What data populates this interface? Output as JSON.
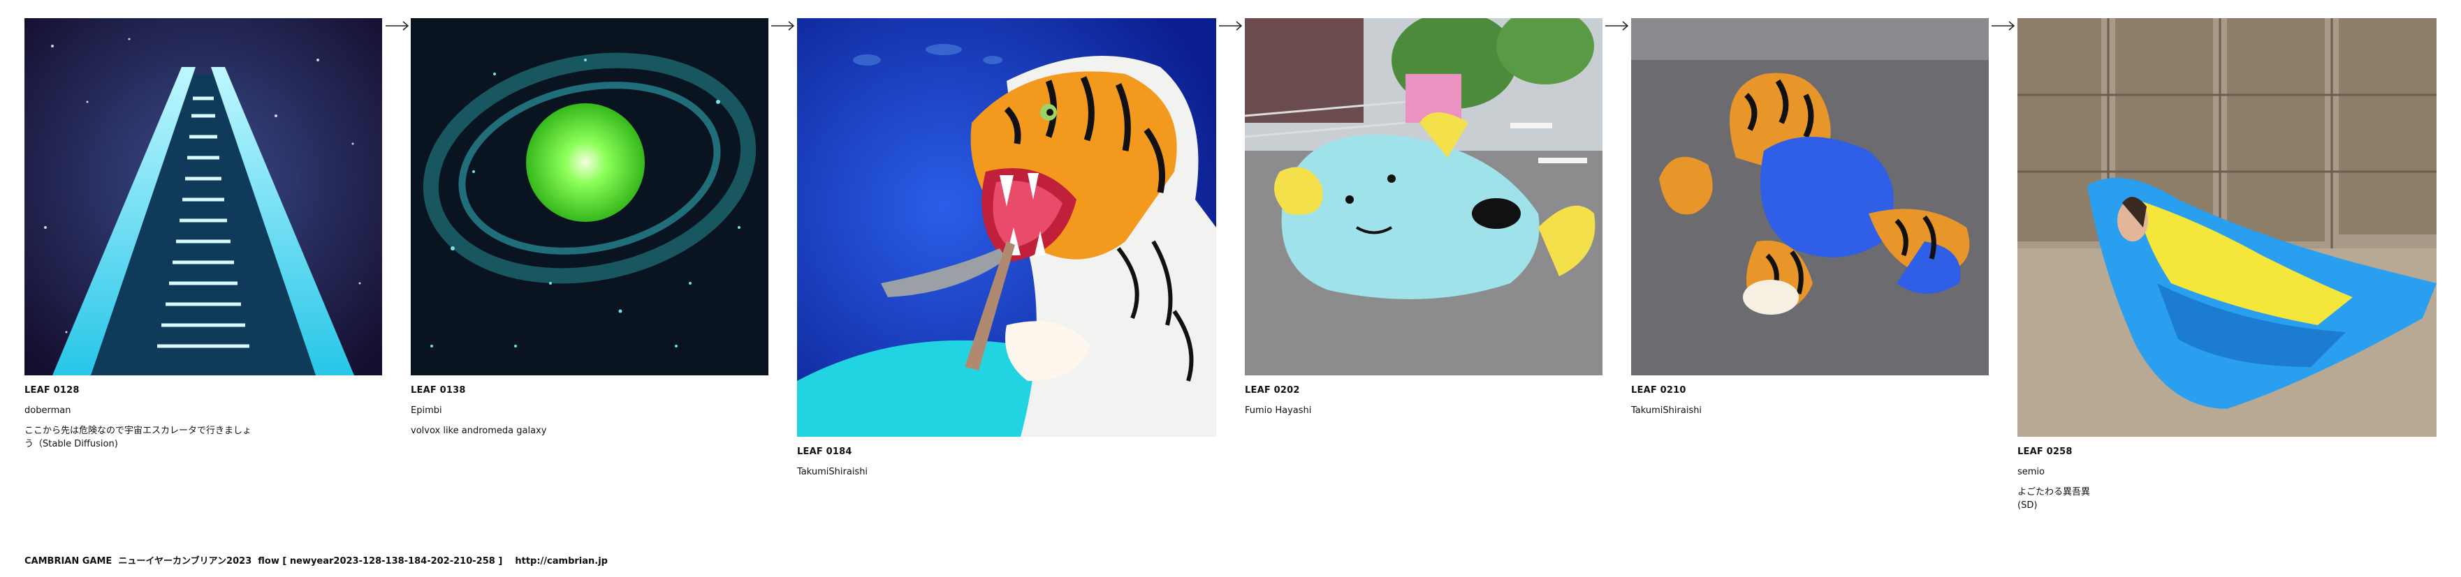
{
  "leaves": [
    {
      "id": "LEAF 0128",
      "author": "doberman",
      "caption": "ここから先は危険なので宇宙エスカレータで行きましょう（Stable Diffusion)"
    },
    {
      "id": "LEAF 0138",
      "author": "Epimbi",
      "caption": "volvox like andromeda galaxy"
    },
    {
      "id": "LEAF 0184",
      "author": "TakumiShiraishi",
      "caption": ""
    },
    {
      "id": "LEAF 0202",
      "author": "Fumio Hayashi",
      "caption": ""
    },
    {
      "id": "LEAF 0210",
      "author": "TakumiShiraishi",
      "caption": ""
    },
    {
      "id": "LEAF 0258",
      "author": "semio",
      "caption": "よごたわる異吾異\n(SD)"
    }
  ],
  "arrow_icon": "arrow-right-icon",
  "footer": "CAMBRIAN GAME  ニューイヤーカンブリアン2023  flow [ newyear2023-128-138-184-202-210-258 ]    http://cambrian.jp"
}
